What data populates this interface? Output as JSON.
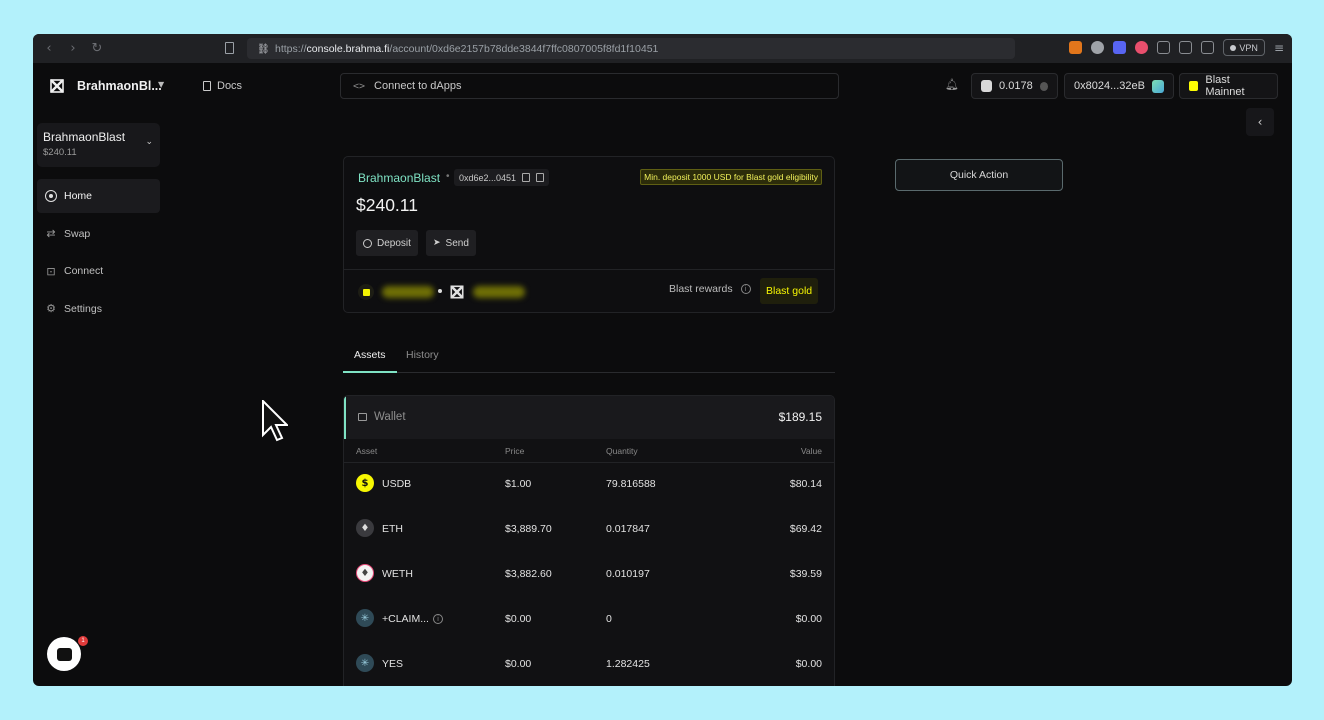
{
  "browser": {
    "url_prefix": "https://",
    "url_host": "console.brahma.fi",
    "url_path": "/account/0xd6e2157b78dde3844f7ffc0807005f8fd1f10451",
    "vpn_label": "VPN"
  },
  "header": {
    "account_name": "BrahmaonBl...",
    "docs_label": "Docs",
    "connect_dapps_label": "Connect to dApps",
    "connect_dapps_icon": "<>",
    "eth_balance": "0.0178",
    "wallet_address": "0x8024...32eB",
    "network": "Blast Mainnet"
  },
  "sidebar": {
    "account_card": {
      "name": "BrahmaonBlast",
      "balance": "$240.11"
    },
    "items": [
      {
        "label": "Home",
        "icon": "home-icon",
        "active": true
      },
      {
        "label": "Swap",
        "icon": "swap-icon",
        "active": false
      },
      {
        "label": "Connect",
        "icon": "connect-icon",
        "active": false
      },
      {
        "label": "Settings",
        "icon": "gear-icon",
        "active": false
      }
    ],
    "chat_badge": "1"
  },
  "account": {
    "name": "BrahmaonBlast",
    "short_address": "0xd6e2...0451",
    "eligibility_note": "Min. deposit 1000 USD for Blast gold eligibility",
    "balance": "$240.11",
    "deposit_label": "Deposit",
    "send_label": "Send",
    "rewards_label": "Blast rewards",
    "blast_gold_label": "Blast gold"
  },
  "quick_action_label": "Quick Action",
  "tabs": [
    {
      "label": "Assets",
      "active": true
    },
    {
      "label": "History",
      "active": false
    }
  ],
  "wallet": {
    "title": "Wallet",
    "total": "$189.15",
    "columns": [
      "Asset",
      "Price",
      "Quantity",
      "Value"
    ],
    "rows": [
      {
        "asset": "USDB",
        "price": "$1.00",
        "quantity": "79.816588",
        "value": "$80.14",
        "icon": "usdb-icon"
      },
      {
        "asset": "ETH",
        "price": "$3,889.70",
        "quantity": "0.017847",
        "value": "$69.42",
        "icon": "eth-icon"
      },
      {
        "asset": "WETH",
        "price": "$3,882.60",
        "quantity": "0.010197",
        "value": "$39.59",
        "icon": "weth-icon"
      },
      {
        "asset": "+CLAIM...",
        "price": "$0.00",
        "quantity": "0",
        "value": "$0.00",
        "icon": "token-icon"
      },
      {
        "asset": "YES",
        "price": "$0.00",
        "quantity": "1.282425",
        "value": "$0.00",
        "icon": "token-icon"
      }
    ]
  },
  "colors": {
    "accent_mint": "#7fe3c4",
    "blast_yellow": "#f7f702",
    "background": "#0c0c0d"
  }
}
